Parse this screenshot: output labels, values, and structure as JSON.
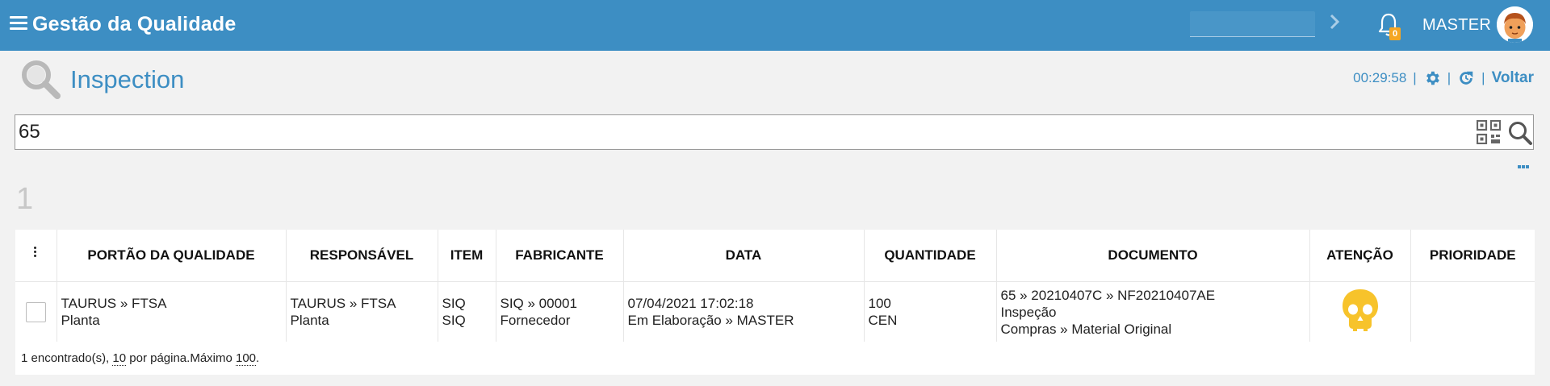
{
  "topbar": {
    "app_title": "Gestão da Qualidade",
    "search_value": "",
    "notification_count": "0",
    "user_name": "MASTER",
    "bar_color": "#3d8ec3"
  },
  "header": {
    "title": "Inspection",
    "timer": "00:29:58",
    "sep": "|",
    "back_label": "Voltar"
  },
  "search": {
    "value": "65"
  },
  "results": {
    "count": "1"
  },
  "table": {
    "columns": [
      "PORTÃO DA QUALIDADE",
      "RESPONSÁVEL",
      "ITEM",
      "FABRICANTE",
      "DATA",
      "QUANTIDADE",
      "DOCUMENTO",
      "ATENÇÃO",
      "PRIORIDADE"
    ],
    "rows": [
      {
        "portao": [
          "TAURUS » FTSA",
          "Planta"
        ],
        "responsavel": [
          "TAURUS » FTSA",
          "Planta"
        ],
        "item": [
          "SIQ",
          "SIQ"
        ],
        "fabricante": [
          "SIQ » 00001",
          "Fornecedor"
        ],
        "data": [
          "07/04/2021 17:02:18",
          "Em Elaboração » MASTER"
        ],
        "quantidade": [
          "100",
          "CEN"
        ],
        "documento": [
          "65 » 20210407C » NF20210407AE",
          "Inspeção",
          "Compras » Material Original"
        ],
        "atencao_icon": "skull-icon",
        "atencao_color": "#f7c32b",
        "prioridade": ""
      }
    ]
  },
  "footer": {
    "found_text": "1 encontrado(s), ",
    "per_page_value": "10",
    "per_page_text": " por página.Máximo ",
    "max_value": "100",
    "end_text": "."
  }
}
